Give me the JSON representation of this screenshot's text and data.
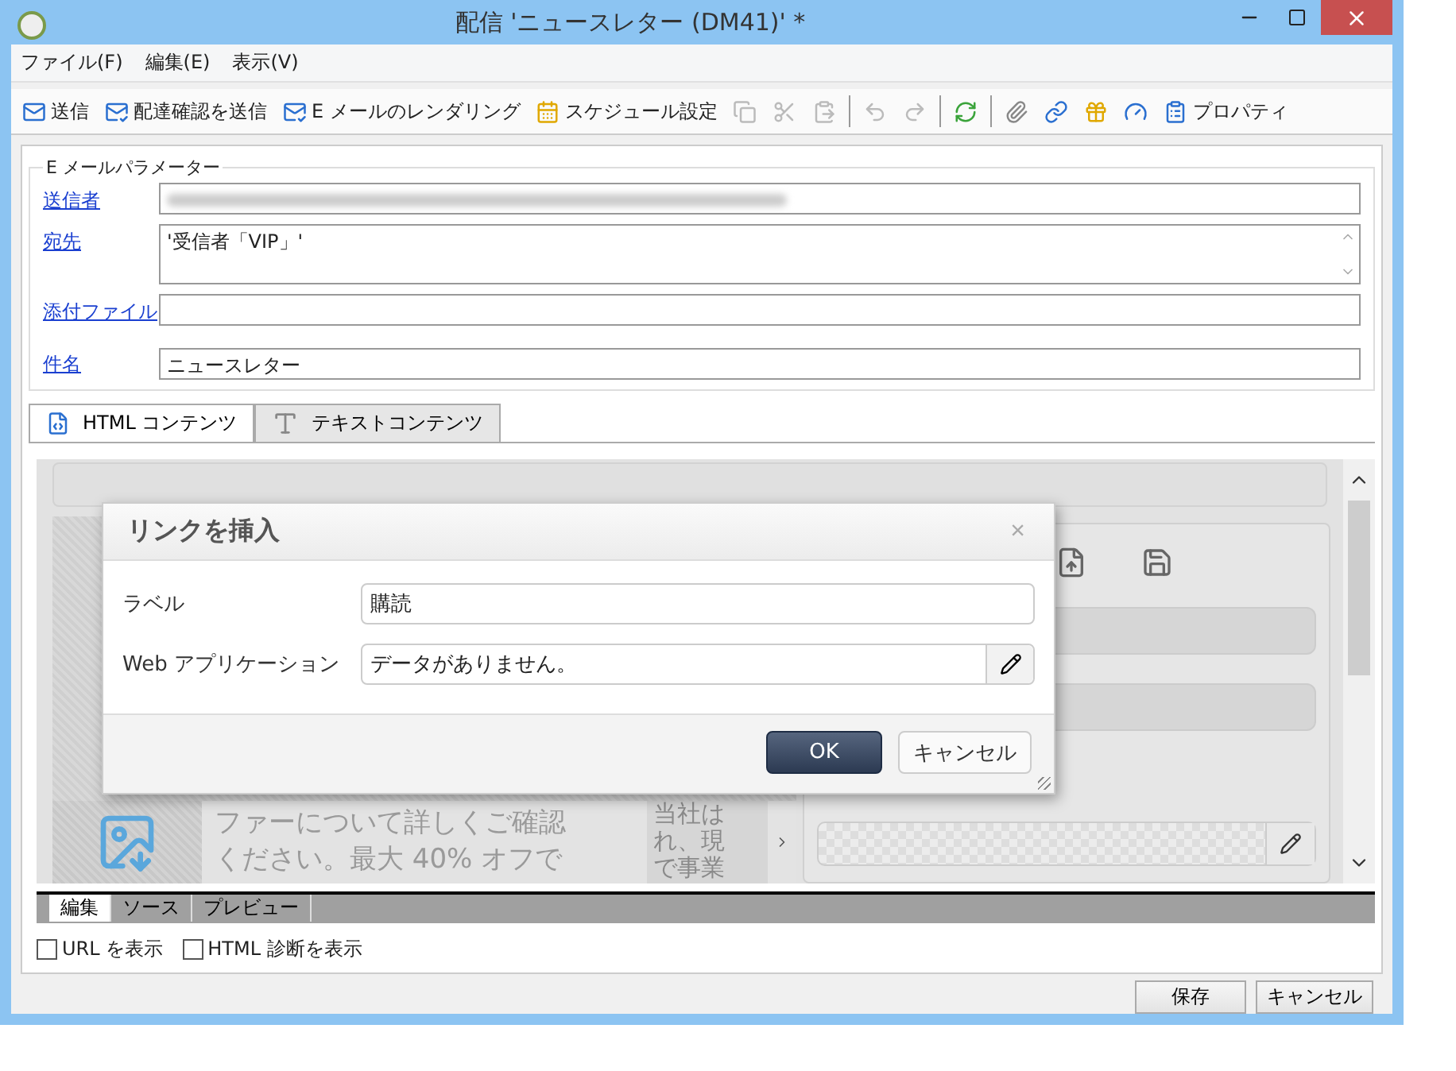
{
  "window": {
    "title": "配信 'ニュースレター (DM41)' *"
  },
  "menu": [
    "ファイル(F)",
    "編集(E)",
    "表示(V)"
  ],
  "toolbar": [
    {
      "kind": "send",
      "label": "送信",
      "disabled": false
    },
    {
      "kind": "proof",
      "label": "配達確認を送信",
      "disabled": false
    },
    {
      "kind": "render",
      "label": "E メールのレンダリング",
      "disabled": false
    },
    {
      "kind": "schedule",
      "label": "スケジュール設定",
      "disabled": false
    },
    {
      "kind": "copy",
      "disabled": true
    },
    {
      "kind": "cut",
      "disabled": true
    },
    {
      "kind": "paste",
      "disabled": true
    },
    {
      "kind": "separator"
    },
    {
      "kind": "undo",
      "disabled": true
    },
    {
      "kind": "redo",
      "disabled": true
    },
    {
      "kind": "separator"
    },
    {
      "kind": "refresh",
      "disabled": false
    },
    {
      "kind": "separator"
    },
    {
      "kind": "attach",
      "disabled": false
    },
    {
      "kind": "link",
      "disabled": false
    },
    {
      "kind": "offer",
      "disabled": false
    },
    {
      "kind": "gauge",
      "disabled": false
    },
    {
      "kind": "properties",
      "label": "プロパティ",
      "disabled": false
    }
  ],
  "parameters": {
    "title": "E メールパラメーター",
    "fields": [
      {
        "label": "送信者",
        "kind": "blurred"
      },
      {
        "label": "宛先",
        "kind": "multiline",
        "value": "'受信者「VIP」'"
      },
      {
        "label": "添付ファイル",
        "kind": "line"
      },
      {
        "label": "件名",
        "kind": "line",
        "value": "ニュースレター"
      }
    ]
  },
  "tabs": [
    {
      "label": "HTML コンテンツ",
      "kind": "html",
      "selected": true
    },
    {
      "label": "テキストコンテンツ",
      "kind": "text",
      "selected": false
    }
  ],
  "editor": {
    "body_text": [
      "ファーについて詳しくご確認",
      "ください。最大 40% オフで"
    ],
    "side_text": [
      "当社は",
      "れ、現",
      "で事業"
    ]
  },
  "editor_tabs": [
    {
      "label": "編集",
      "selected": true
    },
    {
      "label": "ソース",
      "selected": false
    },
    {
      "label": "プレビュー",
      "selected": false
    }
  ],
  "options": [
    {
      "label": "URL を表示",
      "checked": false
    },
    {
      "label": "HTML 診断を表示",
      "checked": false
    }
  ],
  "buttons": [
    "保存",
    "キャンセル"
  ],
  "dialog": {
    "title": "リンクを挿入",
    "close": "×",
    "fields": [
      {
        "label": "ラベル",
        "kind": "text",
        "value": "購読"
      },
      {
        "label": "Web アプリケーション",
        "kind": "picker",
        "value": "データがありません。"
      }
    ],
    "buttons": [
      {
        "label": "OK",
        "kind": "primary"
      },
      {
        "label": "キャンセル",
        "kind": "secondary"
      }
    ]
  }
}
